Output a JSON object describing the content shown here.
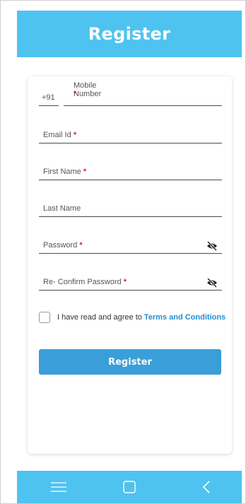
{
  "header": {
    "title": "Register"
  },
  "form": {
    "country_code": "+91",
    "mobile_label": "Mobile Number",
    "email_label": "Email Id",
    "first_name_label": "First Name",
    "last_name_label": "Last Name",
    "password_label": "Password",
    "confirm_password_label": "Re- Confirm Password",
    "required_mark": "*",
    "terms_prefix": "I have read and agree to",
    "terms_link": "Terms and Conditions",
    "submit_label": "Register"
  },
  "nav": {
    "menu_icon": "menu-icon",
    "home_icon": "home-square-icon",
    "back_icon": "back-chevron-icon"
  },
  "colors": {
    "brand": "#4fc3f0",
    "button": "#3a9ed8",
    "link": "#1f8fd0",
    "required": "#e02020"
  }
}
